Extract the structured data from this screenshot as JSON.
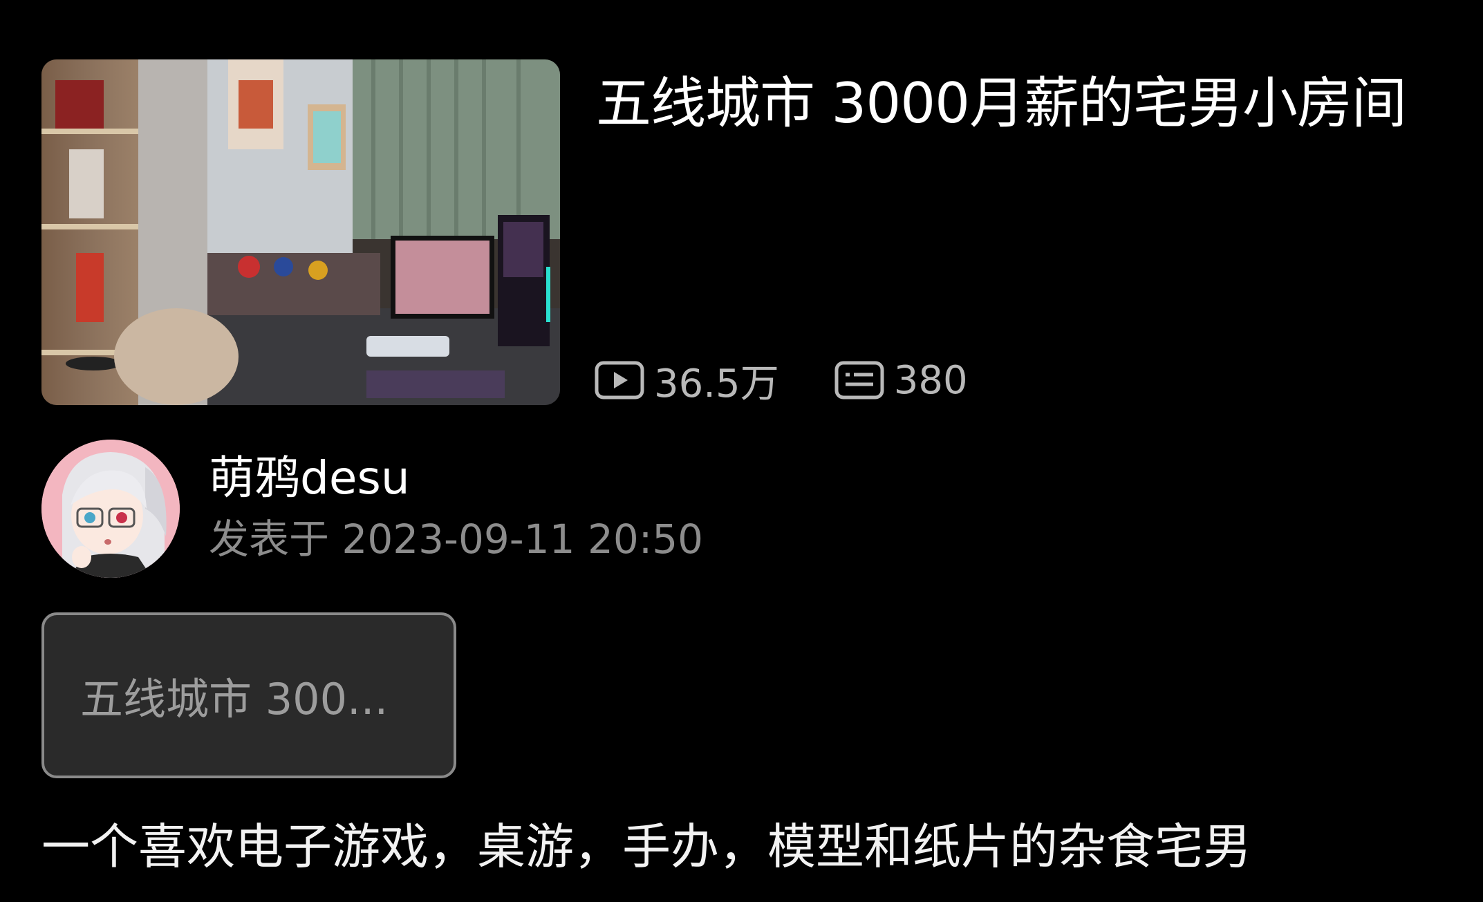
{
  "post": {
    "title": "五线城市 3000月薪的宅男小房间",
    "thumbnail_icon": "room-photo",
    "stats": {
      "views_icon": "play-icon",
      "views": "36.5万",
      "comments_icon": "comment-icon",
      "comments": "380"
    }
  },
  "author": {
    "name": "萌鸦desu",
    "published": "发表于 2023-09-11 20:50",
    "avatar_icon": "anime-avatar"
  },
  "tag": {
    "label": "五线城市 300..."
  },
  "description": "一个喜欢电子游戏，桌游，手办，模型和纸片的杂食宅男",
  "colors": {
    "background": "#000000",
    "primary_text": "#ffffff",
    "secondary_text": "#8c8c8c",
    "stat_text": "#b9b9b9",
    "tag_border": "#8a8a8a",
    "tag_bg": "#2a2a2a"
  }
}
